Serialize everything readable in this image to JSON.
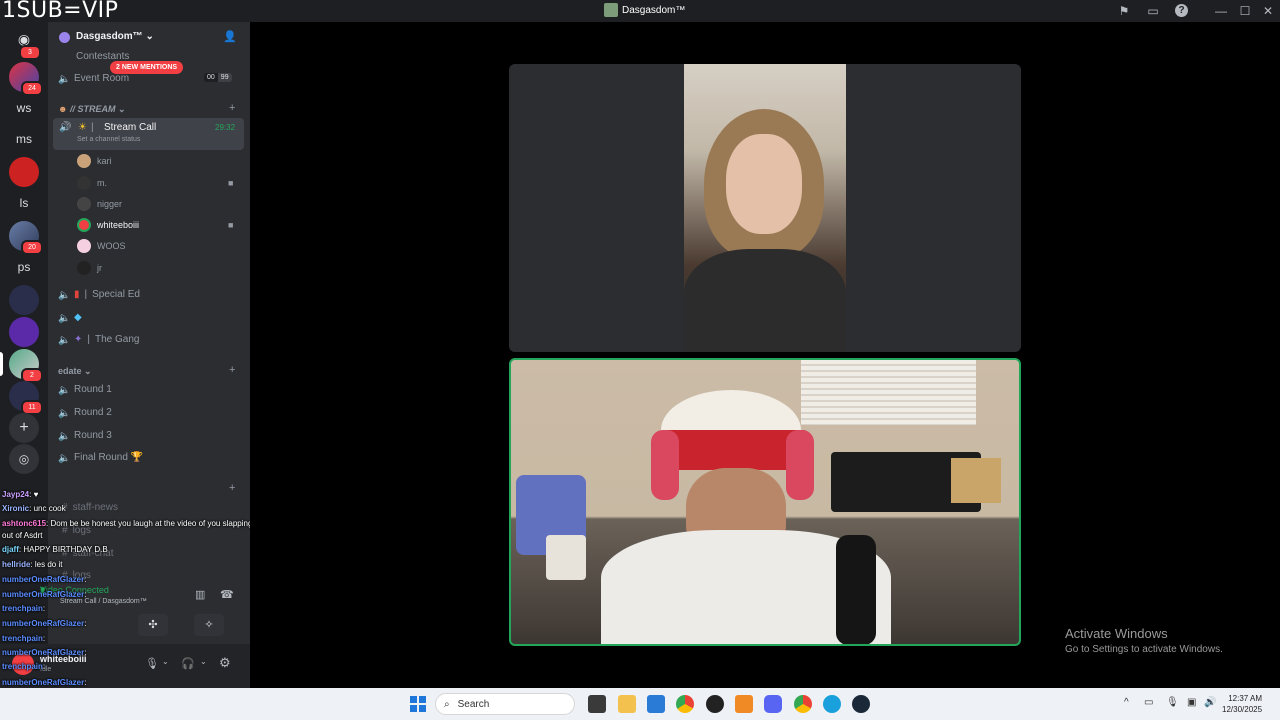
{
  "overlay_text": "1SUB=VIP",
  "window": {
    "title": "Dasgasdom™",
    "buttons": [
      "minimize",
      "maximize",
      "close"
    ]
  },
  "rail": {
    "servers": [
      {
        "label": "",
        "badge": "3"
      },
      {
        "label": "",
        "badge": "24"
      },
      {
        "label": "ws",
        "badge": ""
      },
      {
        "label": "ms",
        "badge": ""
      },
      {
        "label": "",
        "badge": ""
      },
      {
        "label": "ls",
        "badge": ""
      },
      {
        "label": "",
        "badge": "20"
      },
      {
        "label": "ps",
        "badge": ""
      },
      {
        "label": "",
        "badge": ""
      },
      {
        "label": "",
        "badge": ""
      },
      {
        "label": "",
        "badge": "2"
      },
      {
        "label": "",
        "badge": "11"
      }
    ]
  },
  "sidebar": {
    "server_name": "Dasgasdom™ ⌄",
    "mentions_pill": "2 NEW MENTIONS",
    "channels_top": [
      {
        "name": "Contestants"
      },
      {
        "name": "Event Room",
        "counts": [
          "00",
          "99"
        ]
      }
    ],
    "category_stream": "// STREAM",
    "active_channel": {
      "name": "Stream Call",
      "status": "Set a channel status",
      "timer": "29:32"
    },
    "users": [
      "kari",
      "m.",
      "nigger",
      "whiteeboiii",
      "WOOS",
      "jr"
    ],
    "channels_mid": [
      "Special Ed",
      "",
      "The Gang"
    ],
    "category_edate": "edate",
    "rounds": [
      "Round 1",
      "Round 2",
      "Round 3",
      "Final Round 🏆"
    ],
    "text_channels": [
      "staff-news",
      "logs",
      "staff-chat",
      "logs"
    ]
  },
  "chat": {
    "messages": [
      {
        "user": "Jayp24",
        "text": ": ♥"
      },
      {
        "user": "Xironic",
        "text": ": unc cook"
      },
      {
        "user": "ashtonc615",
        "text": ": Dom be be honest you laugh at the video of you slapping the shit"
      },
      {
        "user": "",
        "text": "out of Asdrt"
      },
      {
        "user": "djaff",
        "text": ": HAPPY BIRTHDAY D.B"
      },
      {
        "user": "hellride",
        "text": ": les do it"
      },
      {
        "user": "numberOneRafGlazer",
        "text": ":"
      },
      {
        "user": "numberOneRafGlazer",
        "text": ":"
      },
      {
        "user": "trenchpain",
        "text": ":"
      },
      {
        "user": "numberOneRafGlazer",
        "text": ":"
      },
      {
        "user": "trenchpain",
        "text": ":"
      },
      {
        "user": "numberOneRafGlazer",
        "text": ":"
      },
      {
        "user": "trenchpain",
        "text": ":"
      },
      {
        "user": "numberOneRafGlazer",
        "text": ":"
      },
      {
        "user": "trenchpain",
        "text": ":"
      },
      {
        "user": "trenchpain",
        "text": ":"
      }
    ]
  },
  "voice": {
    "status": "Video Connected",
    "location": "Stream Call / Dasgasdom™"
  },
  "user_panel": {
    "username": "whiteeboiii",
    "status": "Idle"
  },
  "activation": {
    "title": "Activate Windows",
    "subtitle": "Go to Settings to activate Windows."
  },
  "taskbar": {
    "search_placeholder": "Search",
    "time": "12:37 AM",
    "date": "12/30/2025"
  },
  "colors": {
    "discord_dark": "#1e1f22",
    "sidebar": "#2b2d31",
    "speaking_green": "#23a55a",
    "mention_red": "#f23f43"
  }
}
